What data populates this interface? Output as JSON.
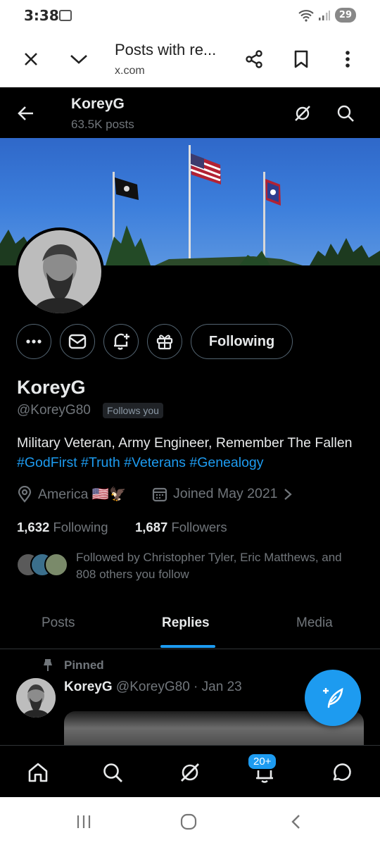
{
  "status_bar": {
    "time": "3:38",
    "battery": "29"
  },
  "browser": {
    "title": "Posts with re...",
    "url": "x.com",
    "icons": [
      "close-icon",
      "chevron-down-icon",
      "share-icon",
      "bookmark-icon",
      "more-vert-icon"
    ]
  },
  "header": {
    "name": "KoreyG",
    "post_count": "63.5K posts"
  },
  "profile": {
    "name": "KoreyG",
    "handle": "@KoreyG80",
    "follows_you": "Follows you",
    "bio_text": "Military Veteran, Army Engineer, Remember The Fallen",
    "bio_hashtags": [
      "#GodFirst",
      "#Truth",
      "#Veterans",
      "#Genealogy"
    ],
    "location": "America 🇺🇸🦅",
    "joined": "Joined May 2021",
    "following_count": "1,632",
    "following_label": "Following",
    "followers_count": "1,687",
    "followers_label": "Followers",
    "followed_by": "Followed by Christopher Tyler, Eric Matthews, and 808 others you follow",
    "following_button": "Following"
  },
  "tabs": [
    {
      "label": "Posts",
      "active": false
    },
    {
      "label": "Replies",
      "active": true
    },
    {
      "label": "Media",
      "active": false
    }
  ],
  "pinned_post": {
    "pinned_label": "Pinned",
    "author": "KoreyG",
    "handle": "@KoreyG80",
    "date": "· Jan 23"
  },
  "bottom_nav": {
    "notifications_badge": "20+"
  },
  "colors": {
    "accent": "#1d9bf0",
    "background": "#000000",
    "muted": "#71767b"
  }
}
